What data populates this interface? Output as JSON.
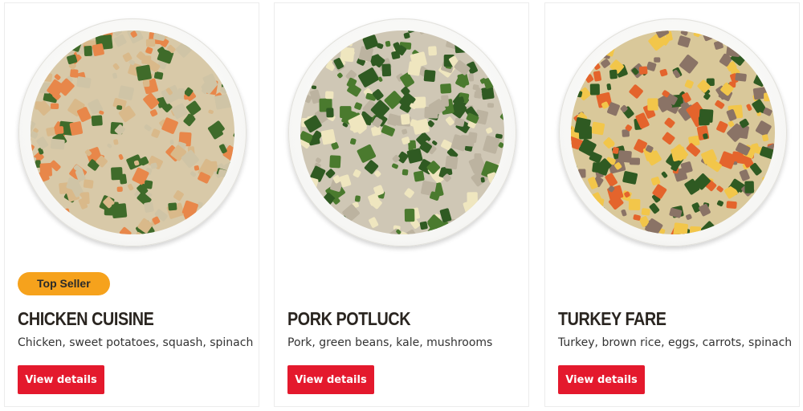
{
  "products": [
    {
      "badge": "Top Seller",
      "title": "CHICKEN CUISINE",
      "description": "Chicken, sweet potatoes, squash, spinach",
      "button_label": "View details",
      "food_colors": {
        "base": "#d8c9a8",
        "chunks": [
          "#e8874a",
          "#d9b98a",
          "#cfc4a6",
          "#3f6b2a"
        ]
      }
    },
    {
      "badge": "",
      "title": "PORK POTLUCK",
      "description": "Pork, green beans, kale, mushrooms",
      "button_label": "View details",
      "food_colors": {
        "base": "#cfc7b5",
        "chunks": [
          "#efe6bf",
          "#bcb3a0",
          "#4a7a2e",
          "#2f5a22"
        ]
      }
    },
    {
      "badge": "",
      "title": "TURKEY FARE",
      "description": "Turkey, brown rice, eggs, carrots, spinach",
      "button_label": "View details",
      "food_colors": {
        "base": "#d9c89a",
        "chunks": [
          "#e4642c",
          "#8a7366",
          "#f2c64a",
          "#2f5a22"
        ]
      }
    }
  ]
}
